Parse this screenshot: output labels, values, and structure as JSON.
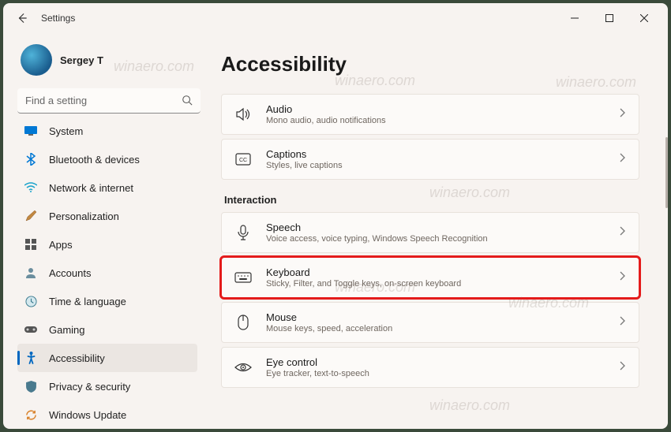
{
  "titlebar": {
    "title": "Settings"
  },
  "profile": {
    "name": "Sergey T"
  },
  "search": {
    "placeholder": "Find a setting"
  },
  "nav": {
    "items": [
      {
        "id": "system",
        "label": "System"
      },
      {
        "id": "bluetooth",
        "label": "Bluetooth & devices"
      },
      {
        "id": "network",
        "label": "Network & internet"
      },
      {
        "id": "personalization",
        "label": "Personalization"
      },
      {
        "id": "apps",
        "label": "Apps"
      },
      {
        "id": "accounts",
        "label": "Accounts"
      },
      {
        "id": "time",
        "label": "Time & language"
      },
      {
        "id": "gaming",
        "label": "Gaming"
      },
      {
        "id": "accessibility",
        "label": "Accessibility"
      },
      {
        "id": "privacy",
        "label": "Privacy & security"
      },
      {
        "id": "windowsupdate",
        "label": "Windows Update"
      }
    ]
  },
  "page": {
    "title": "Accessibility",
    "section_interaction": "Interaction",
    "cards": {
      "audio": {
        "title": "Audio",
        "sub": "Mono audio, audio notifications"
      },
      "captions": {
        "title": "Captions",
        "sub": "Styles, live captions"
      },
      "speech": {
        "title": "Speech",
        "sub": "Voice access, voice typing, Windows Speech Recognition"
      },
      "keyboard": {
        "title": "Keyboard",
        "sub": "Sticky, Filter, and Toggle keys, on-screen keyboard"
      },
      "mouse": {
        "title": "Mouse",
        "sub": "Mouse keys, speed, acceleration"
      },
      "eye": {
        "title": "Eye control",
        "sub": "Eye tracker, text-to-speech"
      }
    }
  },
  "watermark": "winaero.com"
}
